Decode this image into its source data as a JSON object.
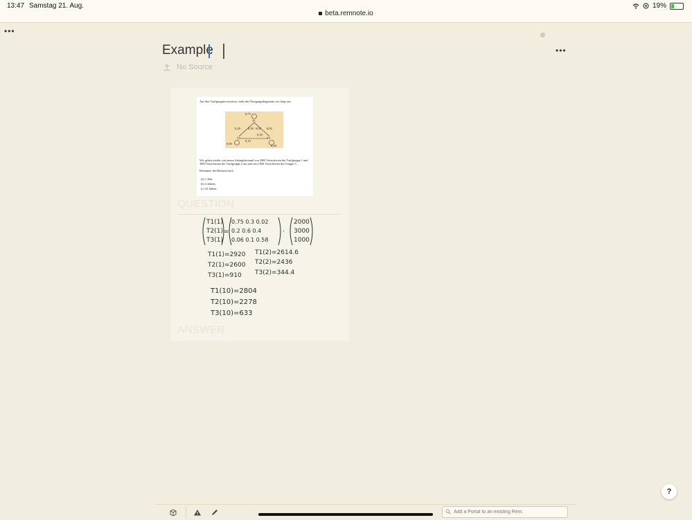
{
  "status_bar": {
    "time": "13:47",
    "date": "Samstag 21. Aug.",
    "url": "beta.remnote.io",
    "battery": "19%"
  },
  "page": {
    "title": "Example",
    "source_label": "No Source"
  },
  "card": {
    "question_label": "QUESTION",
    "answer_label": "ANSWER",
    "problem_text": {
      "intro": "Auf drei Tarifgruppen erweitert, sieht das Übergangsdiagramm wie folgt aus:",
      "body": "Wir gehen wieder von einem Anfangsbestand von 2000 Versicherten der Tarifgruppe 1 und 3000 Versicherten der Tarifgruppe 2 aus und neu 1000 Versicherten der Gruppe 3.",
      "task": "Bestimme den Bestand nach",
      "items": [
        "(a) 1 Jahr,",
        "(b) 2 Jahren,",
        "(c) 10 Jahren."
      ]
    },
    "diagram": {
      "nodes": [
        "T1",
        "T2",
        "T3"
      ],
      "edge_labels": [
        "0,75",
        "0,20",
        "0,30",
        "0,02",
        "0,02",
        "0,30",
        "0,60",
        "0,10",
        "0,98"
      ]
    },
    "handwriting": {
      "matrix_lhs": [
        "T1(1)",
        "T2(1)",
        "T3(1)"
      ],
      "matrix_rows": [
        "0.75  0.3   0.02",
        "0.2   0.6   0.4",
        "0.06  0.1   0.58"
      ],
      "vector": [
        "2000",
        "3000",
        "1000"
      ],
      "results_year1": [
        "T1(1)=2920",
        "T2(1)=2600",
        "T3(1)=910"
      ],
      "results_year2": [
        "T1(2)=2614.6",
        "T2(2)=2436",
        "T3(2)=344.4"
      ],
      "results_year10": [
        "T1(10)=2804",
        "T2(10)=2278",
        "T3(10)=633"
      ]
    }
  },
  "bottom_bar": {
    "portal_placeholder": "Add a Portal to an existing Rem."
  },
  "help_label": "?",
  "icons": {
    "upload": "upload-icon",
    "menu": "more-horizontal-icon",
    "warning": "warning-icon",
    "pen": "pen-icon",
    "cube": "cube-icon",
    "search": "search-icon"
  }
}
